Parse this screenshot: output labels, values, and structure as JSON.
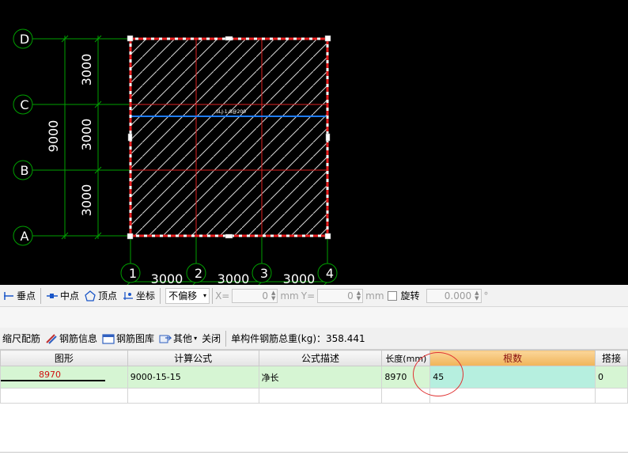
{
  "cad": {
    "row_labels": [
      "D",
      "C",
      "B",
      "A"
    ],
    "col_labels": [
      "1",
      "2",
      "3",
      "4"
    ],
    "vertical_dims": [
      "3000",
      "3000",
      "3000"
    ],
    "total_vertical_dim": "9000",
    "horizontal_dims": [
      "3000",
      "3000",
      "3000"
    ],
    "slab_rebar_label": "SLJ-1-8@200"
  },
  "toolbar1": {
    "perpendicular": "垂点",
    "midpoint": "中点",
    "vertex": "顶点",
    "coordinate": "坐标",
    "offset_mode": "不偏移",
    "x_label": "X=",
    "x_value": "0",
    "y_label": "Y=",
    "y_value": "0",
    "unit": "mm",
    "rotate_label": "旋转",
    "rotate_value": "0.000",
    "degree": "°"
  },
  "toolbar2": {
    "scale_rebar": "缩尺配筋",
    "rebar_info": "钢筋信息",
    "rebar_library": "钢筋图库",
    "other": "其他",
    "close": "关闭",
    "total_weight": "单构件钢筋总重(kg)：358.441"
  },
  "table": {
    "headers": [
      "图形",
      "计算公式",
      "公式描述",
      "长度(mm)",
      "根数",
      "搭接"
    ],
    "row": {
      "shape_length": "8970",
      "formula": "9000-15-15",
      "description": "净长",
      "length": "8970",
      "count": "45",
      "lap": "0"
    }
  },
  "colors": {
    "grid_green": "#00a000",
    "slab_hatch": "#dcdcdc",
    "rebar_blue": "#1e7cff",
    "selection_red": "#e82020",
    "header_active": "#f0b458"
  }
}
